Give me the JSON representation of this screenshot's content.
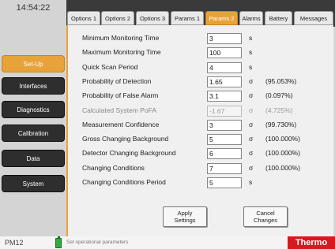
{
  "clock": "14:54:22",
  "tabs": [
    {
      "label": "Options 1",
      "active": false
    },
    {
      "label": "Options 2",
      "active": false
    },
    {
      "label": "Options 3",
      "active": false
    },
    {
      "label": "Params 1",
      "active": false
    },
    {
      "label": "Params 2",
      "active": true
    },
    {
      "label": "Alarms",
      "active": false
    },
    {
      "label": "Battery",
      "active": false
    },
    {
      "label": "Messages",
      "active": false
    }
  ],
  "sidebar": [
    {
      "label": "Set-Up",
      "active": true
    },
    {
      "label": "Interfaces",
      "active": false
    },
    {
      "label": "Diagnostics",
      "active": false
    },
    {
      "label": "Calibration",
      "active": false
    },
    {
      "label": "Data",
      "active": false
    },
    {
      "label": "System",
      "active": false
    }
  ],
  "params": [
    {
      "label": "Minimum Monitoring Time",
      "value": "3",
      "unit": "s",
      "pct": "",
      "disabled": false
    },
    {
      "label": "Maximum Monitoring Time",
      "value": "100",
      "unit": "s",
      "pct": "",
      "disabled": false
    },
    {
      "label": "Quick Scan Period",
      "value": "4",
      "unit": "s",
      "pct": "",
      "disabled": false
    },
    {
      "label": "Probability of Detection",
      "value": "1.65",
      "unit": "σ",
      "pct": "(95.053%)",
      "disabled": false
    },
    {
      "label": "Probability of False Alarm",
      "value": "3.1",
      "unit": "σ",
      "pct": "(0.097%)",
      "disabled": false
    },
    {
      "label": "Calculated System PoFA",
      "value": "-1.67",
      "unit": "σ",
      "pct": "(4.725%)",
      "disabled": true
    },
    {
      "label": "Measurement Confidence",
      "value": "3",
      "unit": "σ",
      "pct": "(99.730%)",
      "disabled": false
    },
    {
      "label": "Gross Changing Background",
      "value": "5",
      "unit": "σ",
      "pct": "(100.000%)",
      "disabled": false
    },
    {
      "label": "Detector Changing Background",
      "value": "6",
      "unit": "σ",
      "pct": "(100.000%)",
      "disabled": false
    },
    {
      "label": "Changing Conditions",
      "value": "7",
      "unit": "σ",
      "pct": "(100.000%)",
      "disabled": false
    },
    {
      "label": "Changing Conditions Period",
      "value": "5",
      "unit": "s",
      "pct": "",
      "disabled": false
    }
  ],
  "buttons": {
    "apply_line1": "Apply",
    "apply_line2": "Settings",
    "cancel_line1": "Cancel",
    "cancel_line2": "Changes"
  },
  "status": {
    "model": "PM12",
    "hint": "Set operational parameters",
    "brand": "Thermo"
  },
  "colors": {
    "accent": "#e8a23a",
    "brand": "#d71920",
    "battery": "#2fae3a"
  }
}
